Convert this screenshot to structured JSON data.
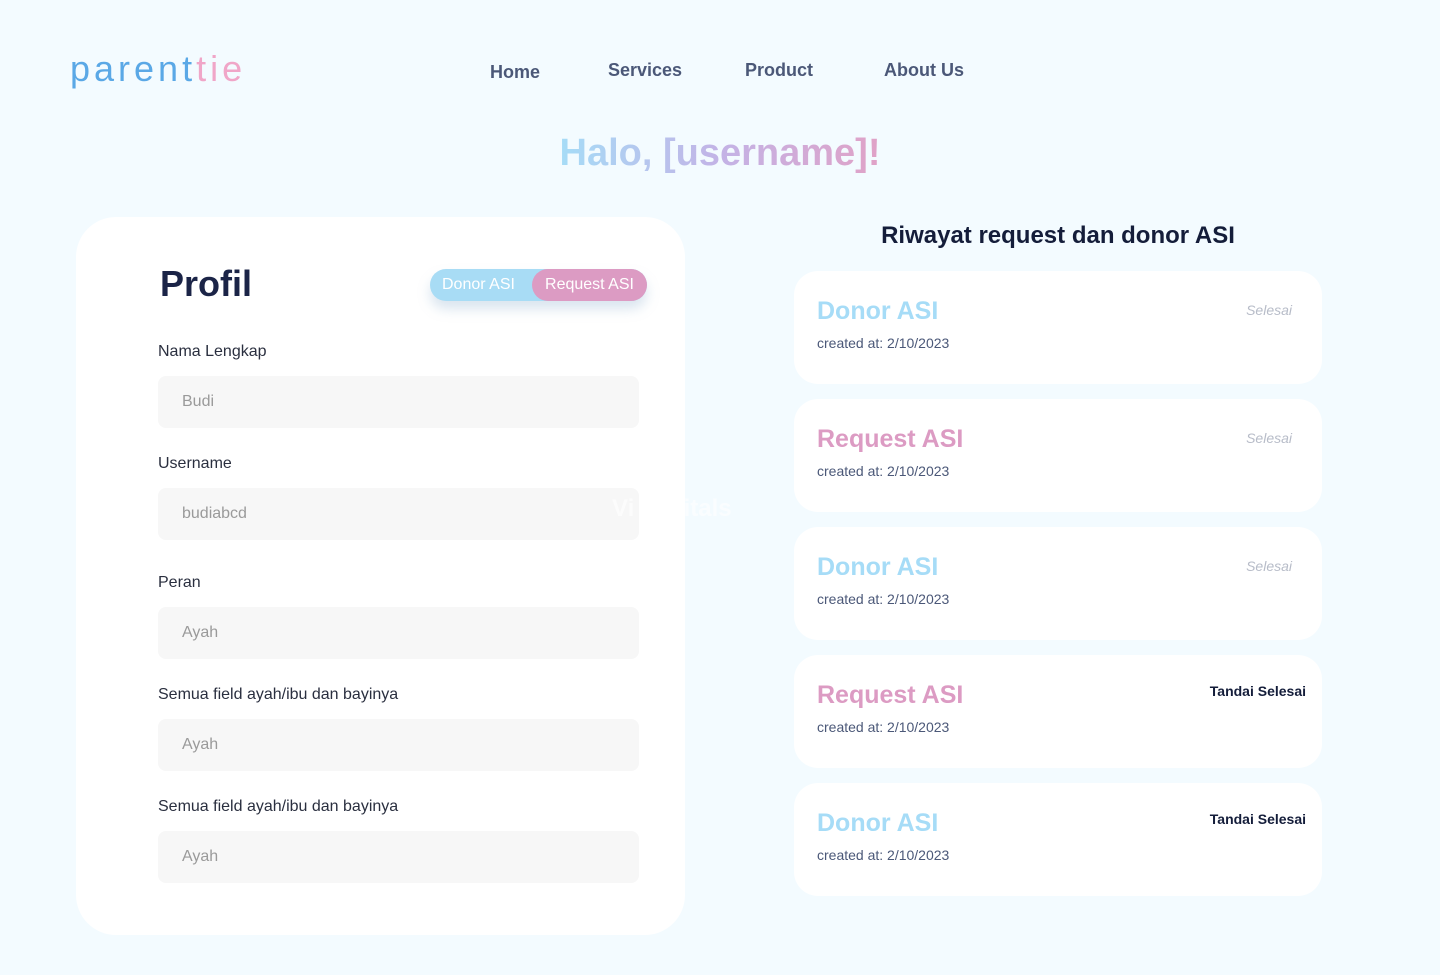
{
  "header": {
    "logo_part_a": "parent",
    "logo_part_b": "ie",
    "logo_mid": "i",
    "nav": [
      "Home",
      "Services",
      "Product",
      "About Us"
    ]
  },
  "greeting": "Halo, [username]!",
  "profile": {
    "title": "Profil",
    "toggle": {
      "donor_label": "Donor ASI",
      "request_label": "Request ASI"
    },
    "fields": [
      {
        "label": "Nama Lengkap",
        "placeholder": "Budi"
      },
      {
        "label": "Username",
        "placeholder": "budiabcd"
      },
      {
        "label": "Peran",
        "placeholder": "Ayah"
      },
      {
        "label": "Semua field ayah/ibu dan bayinya",
        "placeholder": "Ayah"
      },
      {
        "label": "Semua field ayah/ibu dan bayinya",
        "placeholder": "Ayah"
      }
    ]
  },
  "watermark": "Vi   ospitals",
  "history": {
    "title": "Riwayat request dan donor ASI",
    "items": [
      {
        "type": "Donor ASI",
        "kind": "donor",
        "created": "created at: 2/10/2023",
        "status": "Selesai",
        "action": ""
      },
      {
        "type": "Request ASI",
        "kind": "request",
        "created": "created at: 2/10/2023",
        "status": "Selesai",
        "action": ""
      },
      {
        "type": "Donor ASI",
        "kind": "donor",
        "created": "created at: 2/10/2023",
        "status": "Selesai",
        "action": ""
      },
      {
        "type": "Request ASI",
        "kind": "request",
        "created": "created at: 2/10/2023",
        "status": "",
        "action": "Tandai Selesai"
      },
      {
        "type": "Donor ASI",
        "kind": "donor",
        "created": "created at: 2/10/2023",
        "status": "",
        "action": "Tandai Selesai"
      }
    ]
  },
  "colors": {
    "background": "#f3fbff",
    "donor": "#a6dcf7",
    "request": "#dc9bc3",
    "heading": "#1b2447"
  }
}
